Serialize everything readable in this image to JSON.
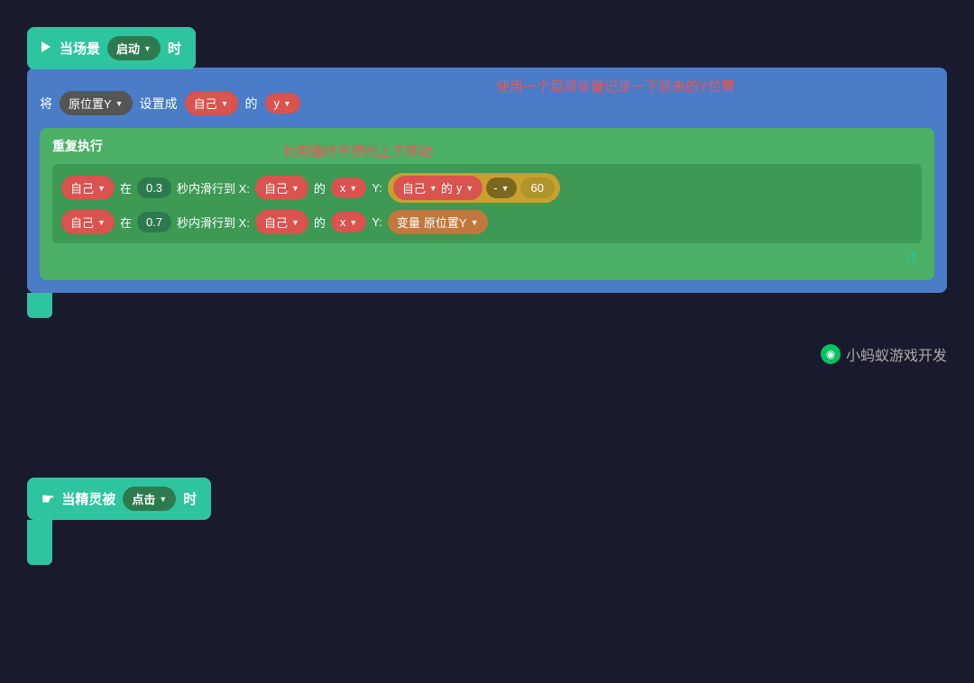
{
  "scene_event": {
    "label": "当场景",
    "trigger": "启动",
    "suffix": "时"
  },
  "set_row": {
    "prefix": "将",
    "var_name": "原位置Y",
    "set_to": "设置成",
    "self_label": "自己",
    "of": "的",
    "prop": "y"
  },
  "repeat_block": {
    "label": "重复执行"
  },
  "motion1": {
    "subject": "自己",
    "in": "在",
    "time": "0.3",
    "time_unit": "秒内滑行到 X:",
    "x_self": "自己",
    "x_of": "的",
    "x_prop": "x",
    "y_label": "Y:",
    "y_self": "自己",
    "y_of": "的",
    "y_prop": "y",
    "minus": "-",
    "value": "60"
  },
  "motion2": {
    "subject": "自己",
    "in": "在",
    "time": "0.7",
    "time_unit": "秒内滑行到 X:",
    "x_self": "自己",
    "x_of": "的",
    "x_prop": "x",
    "y_label": "Y:",
    "y_var_label": "变量",
    "y_var_name": "原位置Y"
  },
  "comment1": "使用一个局部变量记录一下原来的Y位置",
  "comment2": "利用循环不停的上下移动",
  "sprite_event": {
    "label": "当精灵被",
    "trigger": "点击",
    "suffix": "时"
  },
  "watermark": {
    "icon": "◉",
    "text": "小蚂蚁游戏开发"
  }
}
